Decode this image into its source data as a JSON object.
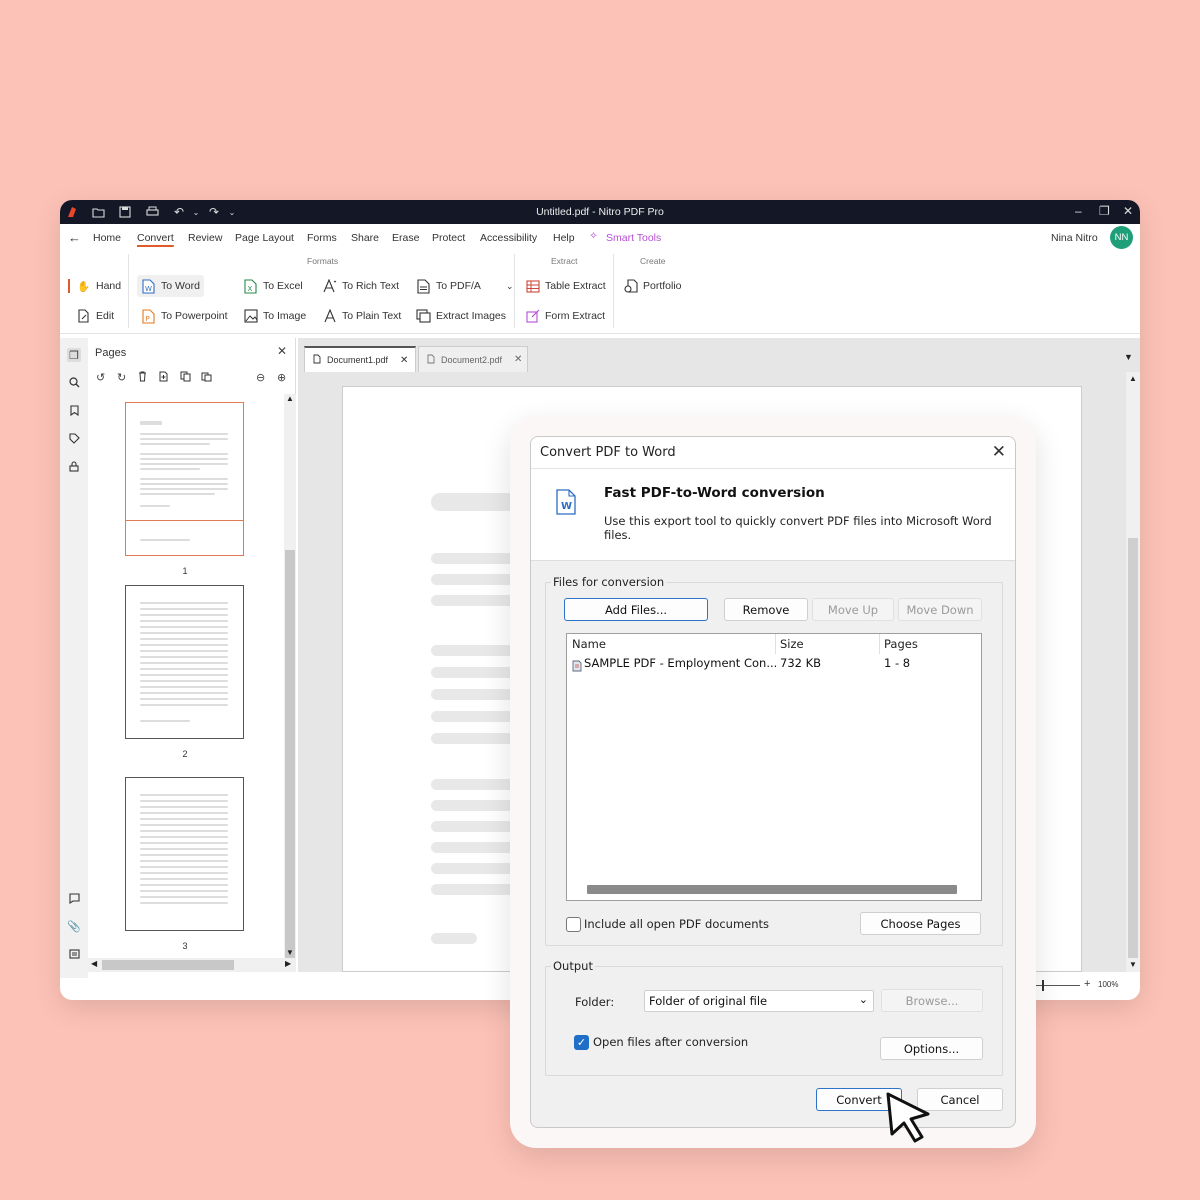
{
  "window": {
    "title": "Untitled.pdf - Nitro PDF Pro",
    "user_name": "Nina Nitro",
    "user_initials": "NN"
  },
  "menu": {
    "items": [
      "Home",
      "Convert",
      "Review",
      "Page Layout",
      "Forms",
      "Share",
      "Erase",
      "Protect",
      "Accessibility",
      "Help"
    ],
    "smart_tools": "Smart Tools",
    "active": "Convert"
  },
  "ribbon": {
    "formats_label": "Formats",
    "extract_label": "Extract",
    "create_label": "Create",
    "hand": "Hand",
    "edit": "Edit",
    "to_word": "To Word",
    "to_powerpoint": "To Powerpoint",
    "to_excel": "To Excel",
    "to_image": "To Image",
    "to_rich_text": "To Rich Text",
    "to_plain_text": "To Plain Text",
    "to_pdfa": "To PDF/A",
    "extract_images": "Extract Images",
    "table_extract": "Table Extract",
    "form_extract": "Form Extract",
    "portfolio": "Portfolio"
  },
  "pages_panel": {
    "title": "Pages",
    "thumbs": [
      "1",
      "2",
      "3"
    ]
  },
  "tabs": {
    "doc1": "Document1.pdf",
    "doc2": "Document2.pdf"
  },
  "zoom": "100%",
  "dialog": {
    "title": "Convert PDF to Word",
    "heading": "Fast PDF-to-Word conversion",
    "description": "Use this export tool to quickly convert PDF files into Microsoft Word files.",
    "files_group": "Files for conversion",
    "add_files": "Add Files...",
    "remove": "Remove",
    "move_up": "Move Up",
    "move_down": "Move Down",
    "columns": {
      "name": "Name",
      "size": "Size",
      "pages": "Pages"
    },
    "file_row": {
      "name": "SAMPLE PDF - Employment Con...",
      "size": "732 KB",
      "pages": "1 - 8"
    },
    "include_all": "Include all open PDF documents",
    "choose_pages": "Choose Pages",
    "output_group": "Output",
    "folder_label": "Folder:",
    "folder_value": "Folder of original file",
    "browse": "Browse...",
    "open_after": "Open files after conversion",
    "open_after_checked": true,
    "include_all_checked": false,
    "options": "Options...",
    "convert": "Convert",
    "cancel": "Cancel"
  },
  "colors": {
    "background": "#fdc2b7",
    "titlebar": "#141726",
    "accent": "#e05a2b",
    "smart_tools": "#b64fd3",
    "avatar": "#1f9e7a",
    "checkbox": "#1f6fc9"
  }
}
